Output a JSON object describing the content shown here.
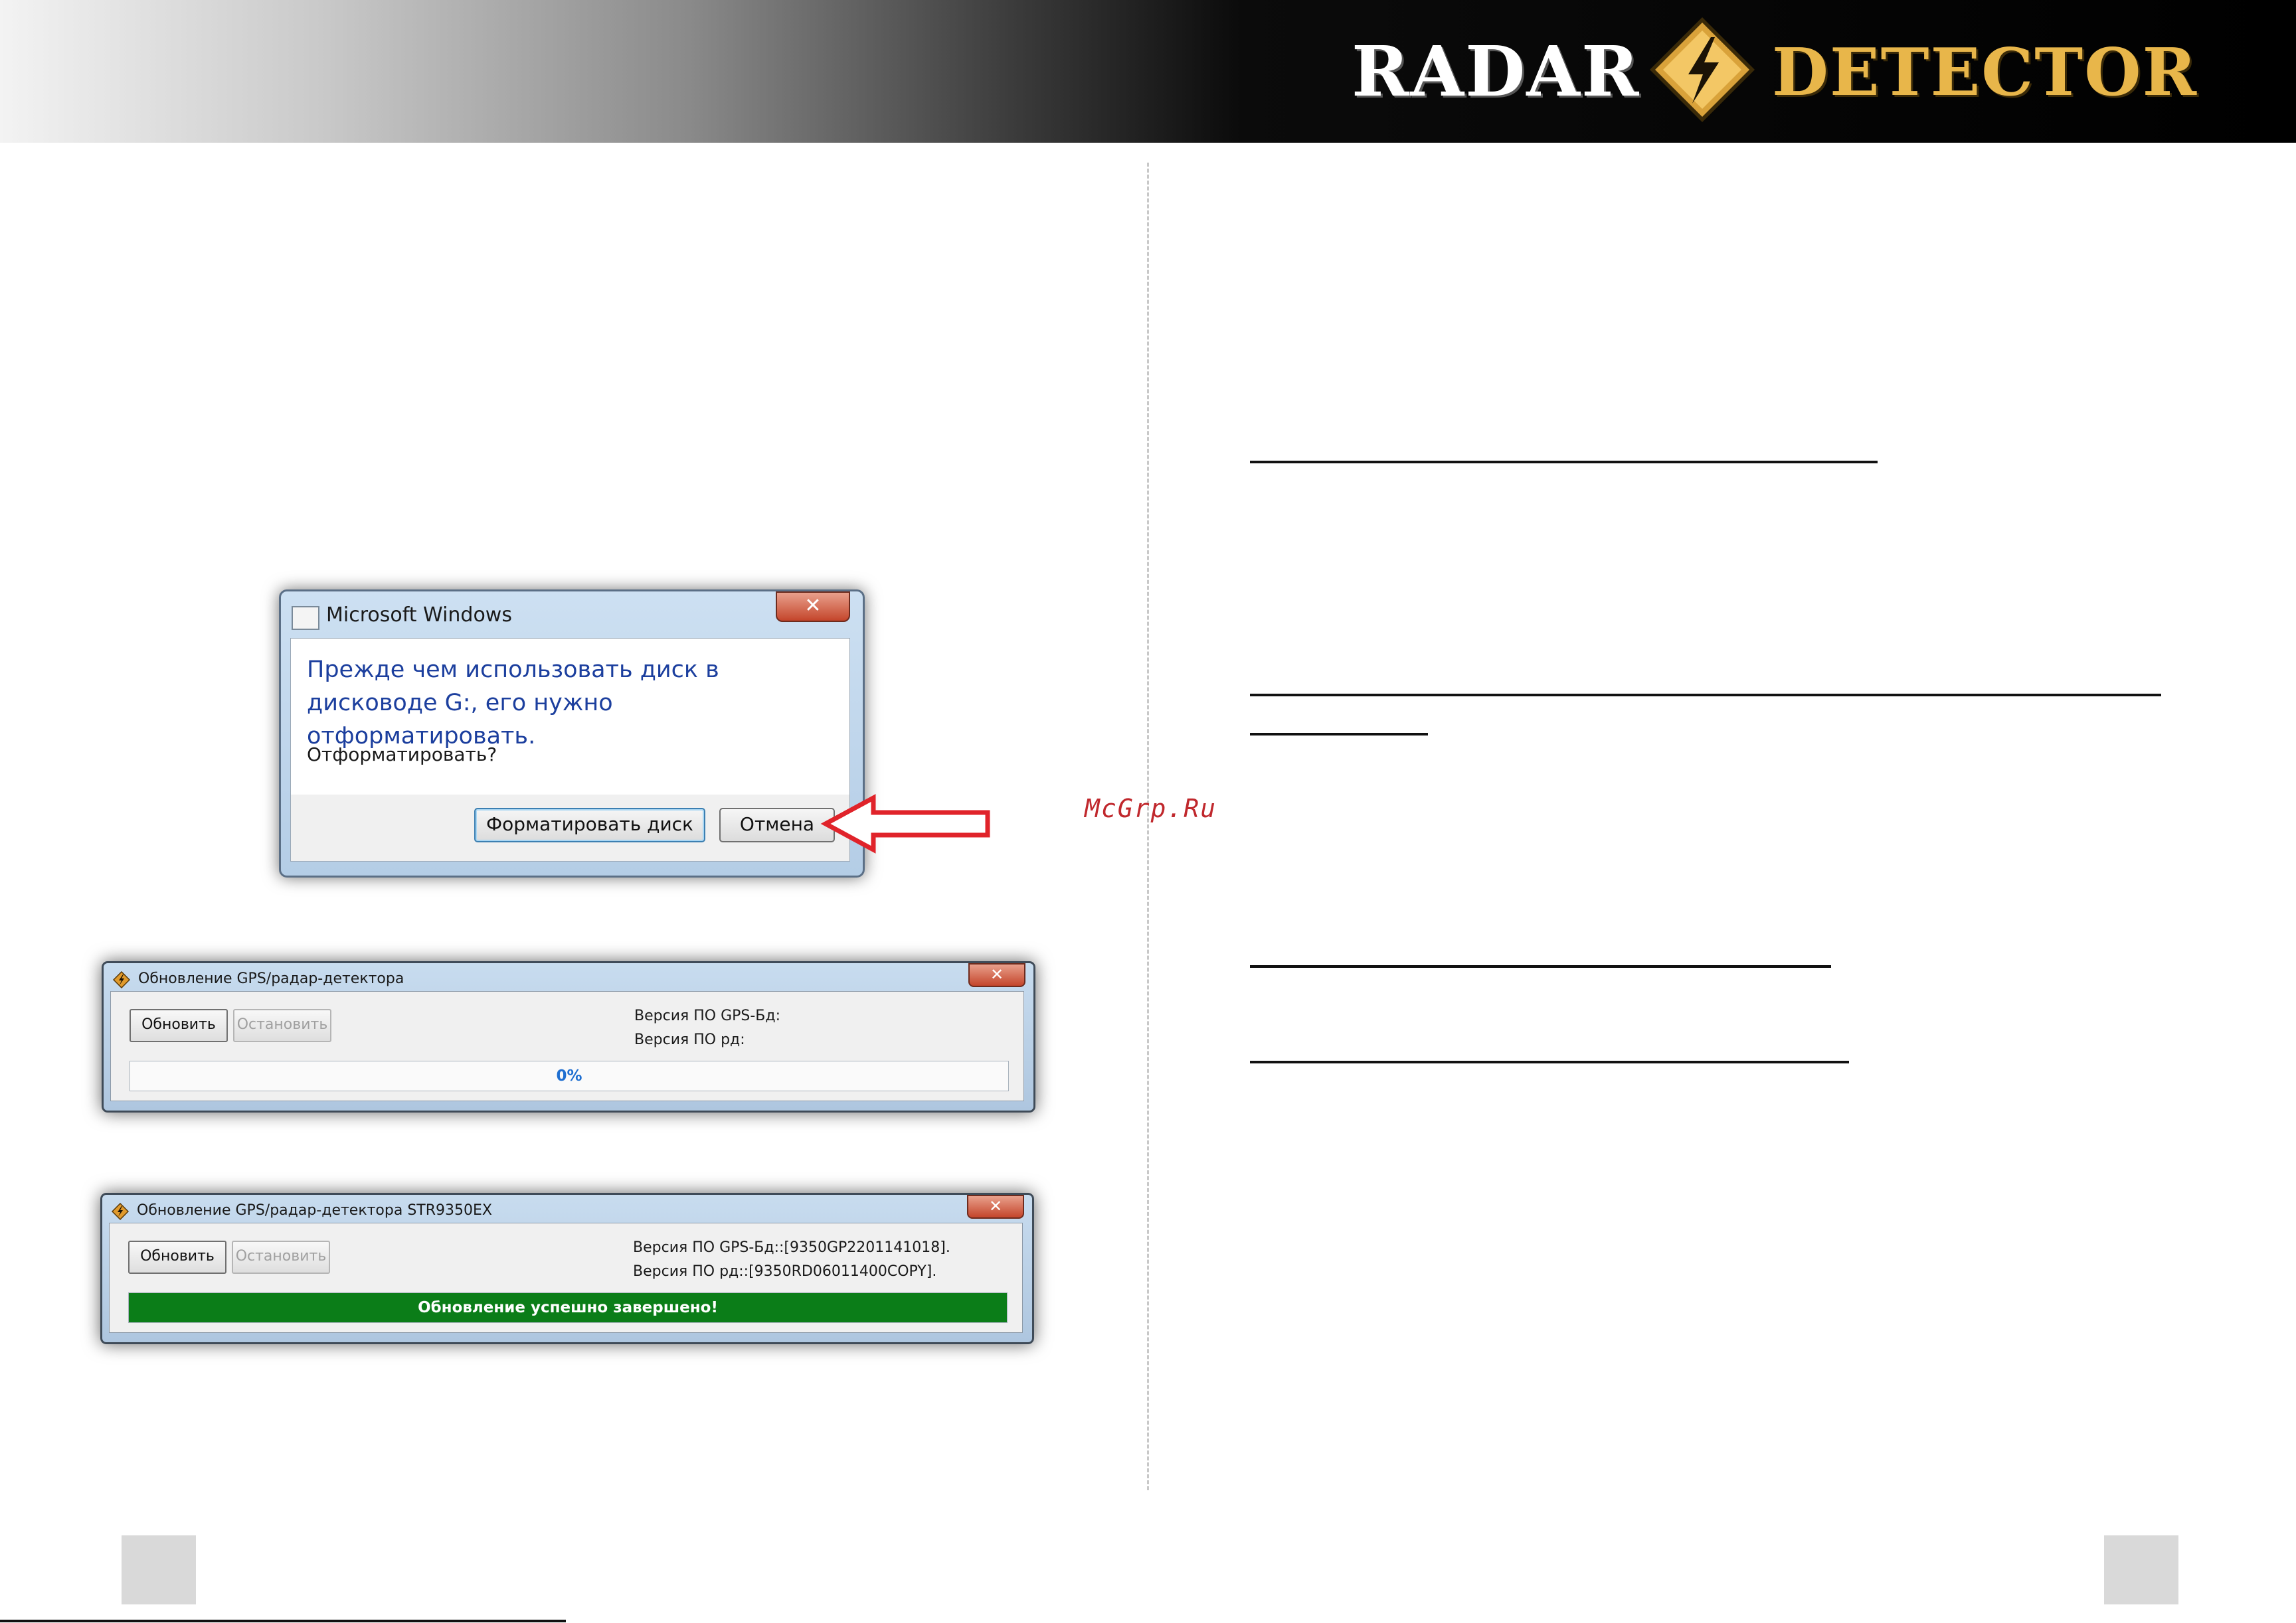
{
  "header": {
    "logo_left": "RADAR",
    "logo_right": "DETECTOR",
    "logo_icon": "lightning-diamond-icon",
    "colors": {
      "logo_gold": "#e8b64a",
      "logo_white": "#ffffff"
    }
  },
  "format_dialog": {
    "title": "Microsoft Windows",
    "message": "Прежде чем использовать диск в дисководе G:, его нужно отформатировать.",
    "question": "Отформатировать?",
    "format_button": "Форматировать диск",
    "cancel_button": "Отмена",
    "close_glyph": "✕",
    "arrow_icon": "red-arrow-icon",
    "colors": {
      "message": "#1c3f9e",
      "arrow": "#e0232a"
    }
  },
  "updater_start": {
    "title": "Обновление GPS/радар-детектора",
    "update_button": "Обновить",
    "stop_button": "Остановить",
    "gps_version": "Версия ПО GPS-Бд:",
    "rd_version": "Версия ПО рд:",
    "progress_text": "0%",
    "progress": 0,
    "close_glyph": "✕"
  },
  "updater_done": {
    "title": "Обновление GPS/радар-детектора  STR9350EX",
    "update_button": "Обновить",
    "stop_button": "Остановить",
    "gps_version": "Версия ПО GPS-Бд::[9350GP2201141018].",
    "rd_version": "Версия ПО рд::[9350RD06011400COPY].",
    "progress_text": "Обновление успешно завершено!",
    "progress": 100,
    "close_glyph": "✕",
    "colors": {
      "progress_fill": "#0b7d18"
    }
  },
  "watermark": "McGrp.Ru"
}
